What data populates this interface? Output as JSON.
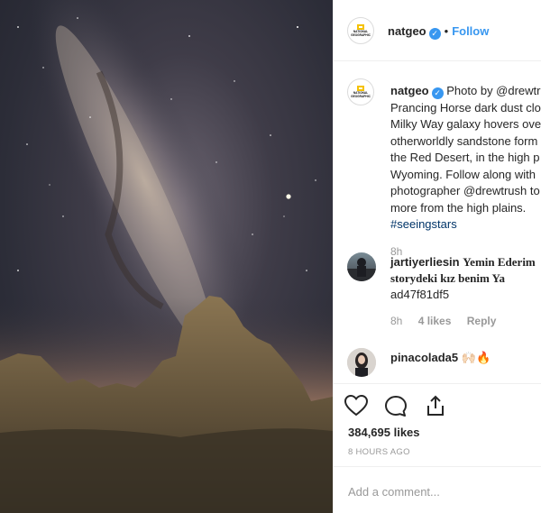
{
  "post": {
    "photo_alt": "Milky Way over sandstone formations",
    "author": "natgeo",
    "follow_label": "Follow",
    "separator": "•",
    "logo_text": "NATIONAL GEOGRAPHIC"
  },
  "caption": {
    "username": "natgeo",
    "lines": [
      "Photo by @drewtr",
      "Prancing Horse dark dust clo",
      "Milky Way galaxy hovers ove",
      "otherworldly sandstone form",
      "the Red Desert, in the high p",
      "Wyoming. Follow along with",
      "photographer @drewtrush to",
      "more from the high plains.",
      "#seeingstars"
    ],
    "time": "8h"
  },
  "comments": [
    {
      "username": "jartiyerliesin",
      "text_line1": "Yemin Ederim",
      "text_line2": "storydeki kız benim Ya",
      "text_line3": "ad47f81df5",
      "time": "8h",
      "likes": "4 likes",
      "reply_label": "Reply"
    },
    {
      "username": "pinacolada5",
      "text_line1": "🙌🏻🔥"
    }
  ],
  "actions": {
    "heart_icon": "heart-icon",
    "comment_icon": "comment-icon",
    "share_icon": "share-icon"
  },
  "stats": {
    "likes": "384,695 likes",
    "time_ago": "8 HOURS AGO"
  },
  "add_comment": {
    "placeholder": "Add a comment..."
  }
}
